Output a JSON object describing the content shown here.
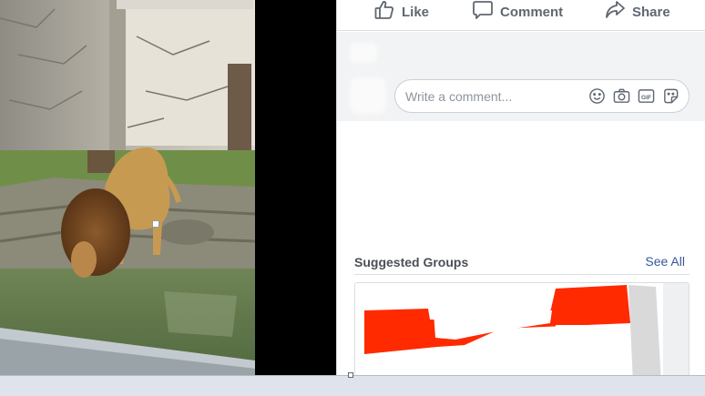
{
  "actions": {
    "like_label": "Like",
    "comment_label": "Comment",
    "share_label": "Share"
  },
  "comment_input": {
    "placeholder": "Write a comment...",
    "value": ""
  },
  "comment_icons": [
    "emoji-icon",
    "camera-icon",
    "gif-icon",
    "sticker-icon"
  ],
  "suggested_groups": {
    "title": "Suggested Groups",
    "see_all_label": "See All"
  },
  "colors": {
    "link": "#385898",
    "action_text": "#606770",
    "panel_bg": "#f2f3f5",
    "group_banner_red": "#ff2a00"
  }
}
